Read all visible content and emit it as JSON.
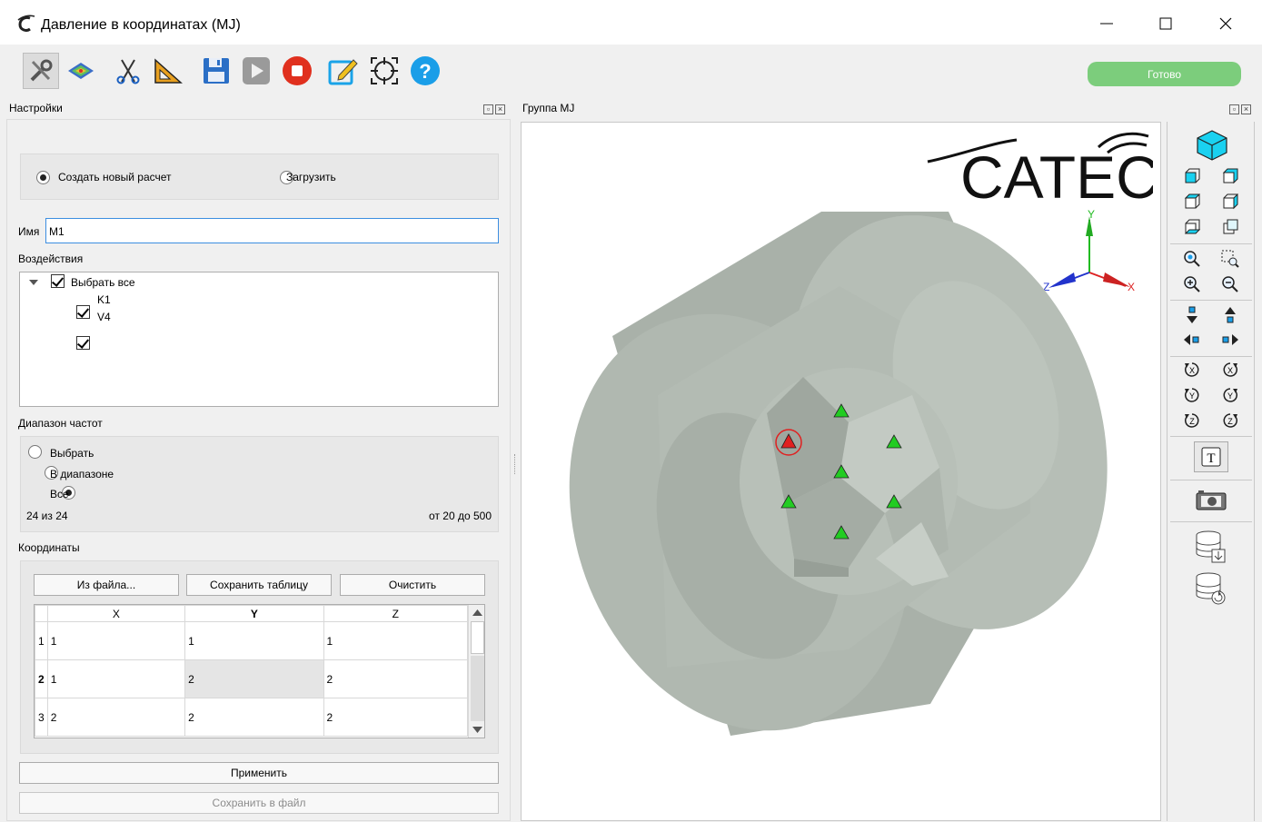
{
  "window": {
    "title": "Давление в координатах (MJ)"
  },
  "toolbar": {
    "icons": [
      "settings-icon",
      "surface-map-icon",
      "scissors-icon",
      "triangle-ruler-icon",
      "save-icon",
      "play-icon",
      "stop-icon",
      "edit-icon",
      "target-icon",
      "help-icon"
    ],
    "status": "Готово",
    "status_color": "#7ccd7c"
  },
  "left_panel": {
    "title": "Настройки",
    "mode": {
      "option_new": "Создать новый расчет",
      "option_load": "Загрузить",
      "selected": "new"
    },
    "name_label": "Имя",
    "name_value": "M1",
    "actions_label": "Воздействия",
    "tree": {
      "select_all": "Выбрать все",
      "items": [
        "K1",
        "V4"
      ]
    },
    "freq_label": "Диапазон частот",
    "freq_options": [
      "Выбрать",
      "В диапазоне",
      "Все"
    ],
    "freq_selected": "Все",
    "freq_count": "24 из 24",
    "freq_range": "от 20 до 500",
    "coords_label": "Координаты",
    "buttons": {
      "from_file": "Из файла...",
      "save_table": "Сохранить таблицу",
      "clear": "Очистить"
    },
    "table": {
      "headers": [
        "X",
        "Y",
        "Z"
      ],
      "rows": [
        {
          "n": "1",
          "x": "1",
          "y": "1",
          "z": "1"
        },
        {
          "n": "2",
          "x": "1",
          "y": "2",
          "z": "2"
        },
        {
          "n": "3",
          "x": "2",
          "y": "2",
          "z": "2"
        }
      ]
    },
    "apply": "Применить",
    "save_file": "Сохранить в файл"
  },
  "viewer": {
    "title": "Группа MJ",
    "logo": "CATEC",
    "axes": {
      "x": "X",
      "y": "Y",
      "z": "Z"
    },
    "model_color": "#b3bbb3",
    "marker_active_color": "#e02020",
    "marker_color": "#22cc22"
  }
}
